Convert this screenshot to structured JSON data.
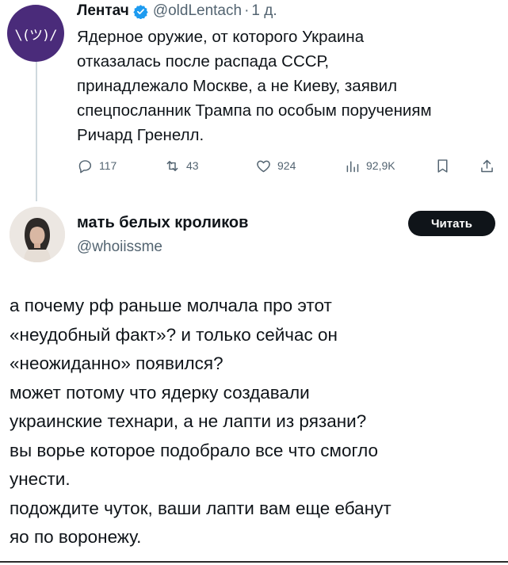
{
  "tweet": {
    "avatar_text": "\\(ツ)/",
    "author_name": "Лентач",
    "author_handle": "@oldLentach",
    "separator": "·",
    "date": "1 д.",
    "text_lines": [
      "Ядерное оружие, от которого Украина",
      "отказалась после распада СССР,",
      "принадлежало Москве, а не Киеву, заявил",
      "спецпосланник Трампа по особым поручениям",
      "Ричард Гренелл."
    ],
    "actions": {
      "replies": "117",
      "reposts": "43",
      "likes": "924",
      "views": "92,9K"
    },
    "colors": {
      "avatar_bg": "#4a2b7a",
      "verified": "#1d9bf0",
      "secondary_text": "#536471"
    }
  },
  "reply": {
    "author_name": "мать белых кроликов",
    "author_handle": "@whoiissme",
    "read_button": "Читать",
    "text_lines": [
      "а почему рф раньше молчала про этот",
      "«неудобный факт»? и только сейчас он",
      "«неожиданно» появился?",
      "может потому что ядерку создавали",
      "украинские технари, а не лапти из рязани?",
      "вы ворье которое подобрало все что смогло",
      "унести.",
      "подождите чуток, ваши лапти вам еще ебанут",
      "яо по воронежу."
    ]
  }
}
